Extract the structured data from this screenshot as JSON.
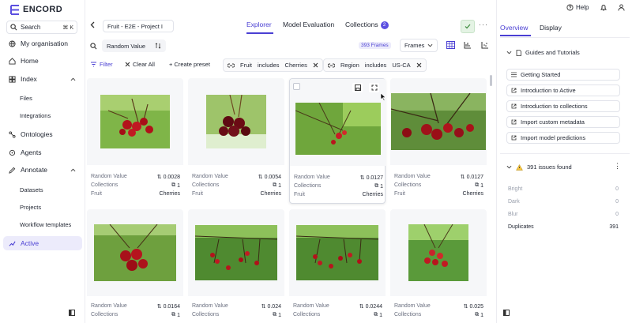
{
  "app": {
    "brand": "ENCORD",
    "accent": "#4a3fd3"
  },
  "sidebar": {
    "search": {
      "label": "Search",
      "shortcut": "⌘ K"
    },
    "items": [
      {
        "label": "My organisation",
        "icon": "globe-icon"
      },
      {
        "label": "Home",
        "icon": "home-icon"
      },
      {
        "label": "Index",
        "icon": "index-icon"
      },
      {
        "label": "Files",
        "icon": ""
      },
      {
        "label": "Integrations",
        "icon": ""
      },
      {
        "label": "Ontologies",
        "icon": "ontology-icon"
      },
      {
        "label": "Agents",
        "icon": "agents-icon"
      },
      {
        "label": "Annotate",
        "icon": "annotate-icon"
      },
      {
        "label": "Datasets",
        "icon": ""
      },
      {
        "label": "Projects",
        "icon": ""
      },
      {
        "label": "Workflow templates",
        "icon": ""
      },
      {
        "label": "Active",
        "icon": "active-icon"
      }
    ]
  },
  "header": {
    "project": "Fruit - E2E - Project I",
    "tabs": [
      {
        "label": "Explorer"
      },
      {
        "label": "Model Evaluation"
      },
      {
        "label": "Collections",
        "badge": "2"
      }
    ]
  },
  "toolbar": {
    "sort": "Random Value",
    "frames_count": "393 Frames",
    "frames_select": "Frames"
  },
  "filters": {
    "filter_label": "Filter",
    "clear_label": "Clear All",
    "preset_label": "+ Create preset",
    "chips": [
      {
        "field": "Fruit",
        "op": "includes",
        "value": "Cherries"
      },
      {
        "field": "Region",
        "op": "includes",
        "value": "US-CA"
      }
    ]
  },
  "cards": [
    {
      "random_value_label": "Random Value",
      "random_value": "0.0028",
      "collections_label": "Collections",
      "collections": "1",
      "fruit_label": "Fruit",
      "fruit": "Cherries"
    },
    {
      "random_value_label": "Random Value",
      "random_value": "0.0054",
      "collections_label": "Collections",
      "collections": "1",
      "fruit_label": "Fruit",
      "fruit": "Cherries"
    },
    {
      "random_value_label": "Random Value",
      "random_value": "0.0127",
      "collections_label": "Collections",
      "collections": "1",
      "fruit_label": "Fruit",
      "fruit": "Cherries"
    },
    {
      "random_value_label": "Random Value",
      "random_value": "0.0127",
      "collections_label": "Collections",
      "collections": "1",
      "fruit_label": "Fruit",
      "fruit": "Cherries"
    },
    {
      "random_value_label": "Random Value",
      "random_value": "0.0164",
      "collections_label": "Collections",
      "collections": "1"
    },
    {
      "random_value_label": "Random Value",
      "random_value": "0.024",
      "collections_label": "Collections",
      "collections": "1"
    },
    {
      "random_value_label": "Random Value",
      "random_value": "0.0244",
      "collections_label": "Collections",
      "collections": "1"
    },
    {
      "random_value_label": "Random Value",
      "random_value": "0.025",
      "collections_label": "Collections",
      "collections": "1"
    }
  ],
  "right_panel": {
    "help": "Help",
    "tabs": [
      {
        "label": "Overview"
      },
      {
        "label": "Display"
      }
    ],
    "guides_title": "Guides and Tutorials",
    "guides": [
      {
        "label": "Getting Started",
        "icon": "list-icon"
      },
      {
        "label": "Introduction to Active",
        "icon": "external-link-icon"
      },
      {
        "label": "Introduction to collections",
        "icon": "external-link-icon"
      },
      {
        "label": "Import custom metadata",
        "icon": "external-link-icon"
      },
      {
        "label": "Import model predictions",
        "icon": "external-link-icon"
      }
    ],
    "issues_title": "391 issues found",
    "issues": [
      {
        "label": "Bright",
        "count": "0"
      },
      {
        "label": "Dark",
        "count": "0"
      },
      {
        "label": "Blur",
        "count": "0"
      },
      {
        "label": "Duplicates",
        "count": "391"
      }
    ]
  }
}
